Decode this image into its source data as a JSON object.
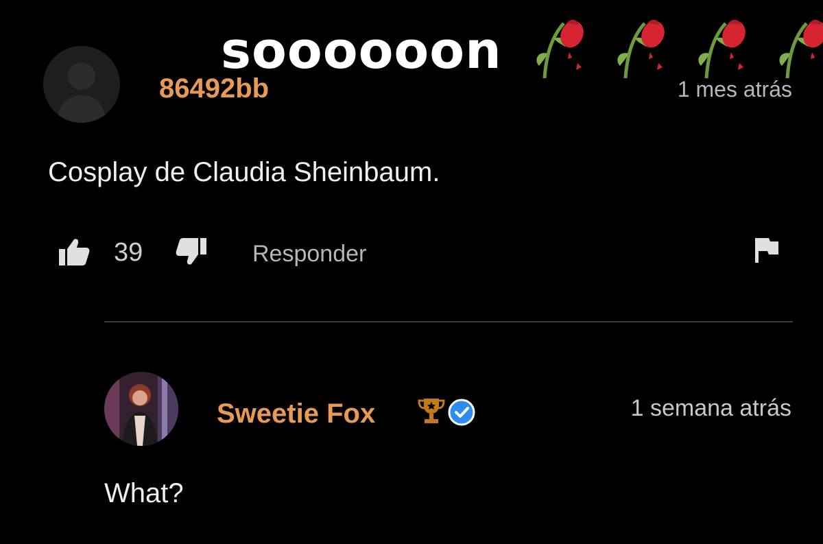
{
  "overlay": {
    "caption": "soooooon",
    "emoji": [
      "wilted-rose-emoji",
      "wilted-rose-emoji",
      "wilted-rose-emoji",
      "wilted-rose-emoji"
    ]
  },
  "comment": {
    "username": "86492bb",
    "timestamp": "1 mes atrás",
    "text": "Cosplay de Claudia Sheinbaum.",
    "like_count": "39",
    "reply_label": "Responder",
    "icons": [
      "default-avatar-icon",
      "thumbs-up-icon",
      "thumbs-down-icon",
      "flag-icon"
    ]
  },
  "reply": {
    "username": "Sweetie Fox",
    "timestamp": "1 semana atrás",
    "text": "What?",
    "icons": [
      "trophy-icon",
      "verified-badge-icon"
    ]
  },
  "colors": {
    "background": "#000000",
    "username": "#e79a56",
    "verified": "#2d8cf0",
    "trophy": "#c27a1a",
    "rose": "#d62530",
    "stem": "#6c9a3c"
  }
}
